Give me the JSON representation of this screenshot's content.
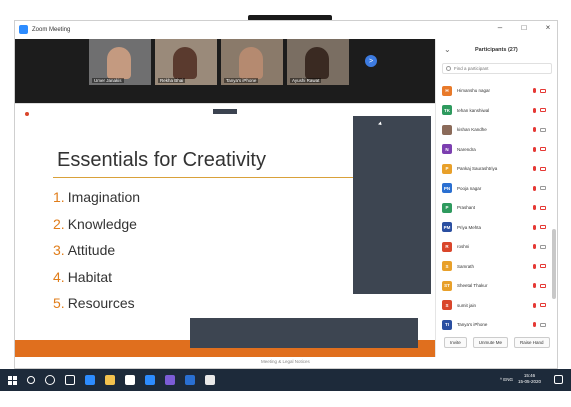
{
  "window": {
    "title": "Zoom Meeting",
    "controls": [
      "–",
      "□",
      "×"
    ]
  },
  "video_strip": {
    "tiles": [
      {
        "name": "Umer Janakis"
      },
      {
        "name": "Rekha Bhai"
      },
      {
        "name": "Tanya's iPhone"
      },
      {
        "name": "Ayushi Rawat"
      }
    ],
    "next_page_label": ">"
  },
  "slide": {
    "title": "Essentials for Creativity",
    "items": [
      {
        "num": "1.",
        "text": "Imagination"
      },
      {
        "num": "2.",
        "text": "Knowledge"
      },
      {
        "num": "3.",
        "text": "Attitude"
      },
      {
        "num": "4.",
        "text": "Habitat"
      },
      {
        "num": "5.",
        "text": "Resources"
      }
    ],
    "accent_color": "#e06f1e"
  },
  "bottom_caption": "Meeting & Legal Notices",
  "participants": {
    "collapse_label": "⌄",
    "title": "Participants (27)",
    "search_placeholder": "Find a participant",
    "list": [
      {
        "name": "Himanshu nagar",
        "avatar_letter": "H",
        "avatar_color": "#e87a2a",
        "cam": "on"
      },
      {
        "name": "tehan kanshiwal",
        "avatar_letter": "TK",
        "avatar_color": "#2e9a5e",
        "cam": "on"
      },
      {
        "name": "kishan Kandhe",
        "avatar_letter": "",
        "avatar_color": "#8b6b5a",
        "cam": "off"
      },
      {
        "name": "Narendra",
        "avatar_letter": "N",
        "avatar_color": "#7c3fb0",
        "cam": "on"
      },
      {
        "name": "Pankaj Saurashtriya",
        "avatar_letter": "P",
        "avatar_color": "#e8a02a",
        "cam": "on"
      },
      {
        "name": "Pooja nagar",
        "avatar_letter": "PN",
        "avatar_color": "#2a6fd1",
        "cam": "off"
      },
      {
        "name": "Prashant",
        "avatar_letter": "P",
        "avatar_color": "#2e9a5e",
        "cam": "on"
      },
      {
        "name": "Priya Mehta",
        "avatar_letter": "PM",
        "avatar_color": "#2a4fa1",
        "cam": "on"
      },
      {
        "name": "roshni",
        "avatar_letter": "R",
        "avatar_color": "#d9462b",
        "cam": "off"
      },
      {
        "name": "Samrath",
        "avatar_letter": "S",
        "avatar_color": "#e8a02a",
        "cam": "on"
      },
      {
        "name": "Sheetal Thakur",
        "avatar_letter": "ST",
        "avatar_color": "#e8a02a",
        "cam": "on"
      },
      {
        "name": "sumit jain",
        "avatar_letter": "S",
        "avatar_color": "#d9462b",
        "cam": "on"
      },
      {
        "name": "Tanya's iPhone",
        "avatar_letter": "TI",
        "avatar_color": "#2a4fa1",
        "cam": "off"
      }
    ],
    "buttons": [
      "Invite",
      "Unmute Me",
      "Raise Hand"
    ]
  },
  "taskbar": {
    "tray_text": "^ ENG",
    "time": "15:46",
    "date": "15-05-2020",
    "app_colors": [
      "#2d8cff",
      "#f2c14e",
      "#ffffff",
      "#2d8cff",
      "#7b5cd6",
      "#2a6fd1",
      "#e8e8e8"
    ]
  }
}
